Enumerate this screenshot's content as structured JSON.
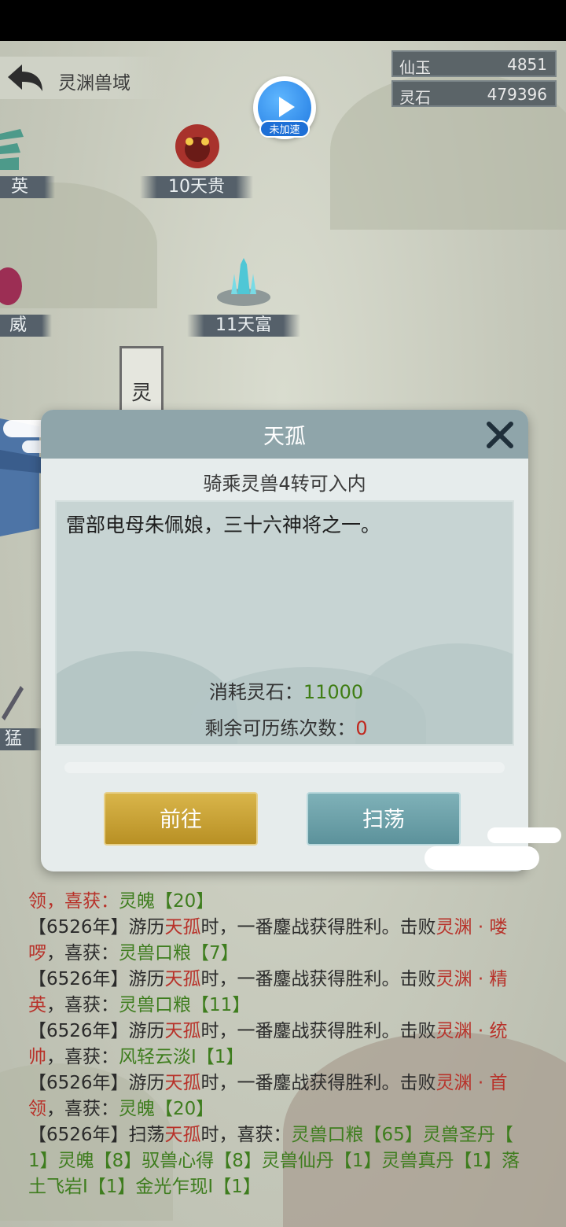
{
  "header": {
    "area_title": "灵渊兽域"
  },
  "resources": [
    {
      "label": "仙玉",
      "value": "4851"
    },
    {
      "label": "灵石",
      "value": "479396"
    }
  ],
  "speed": {
    "label": "未加速"
  },
  "map_nodes": {
    "n1": "英",
    "n2": "10天贵",
    "n3": "威",
    "n4": "11天富",
    "n5": "猛",
    "banner": "灵"
  },
  "dialog": {
    "title": "天孤",
    "requirement": "骑乘灵兽4转可入内",
    "description": "雷部电母朱佩娘，三十六神将之一。",
    "cost_label": "消耗灵石：",
    "cost_value": "11000",
    "remain_label": "剩余可历练次数：",
    "remain_value": "0",
    "go_button": "前往",
    "sweep_button": "扫荡"
  },
  "log": {
    "l1a": "领，喜获：",
    "l1b": "灵魄【20】",
    "l2a": "【6526年】游历",
    "l2b": "天孤",
    "l2c": "时，一番鏖战获得胜利。击败",
    "l2d": "灵渊 · 喽",
    "l3a": "啰",
    "l3b": "，喜获：",
    "l3c": "灵兽口粮【7】",
    "l4a": "【6526年】游历",
    "l4b": "天孤",
    "l4c": "时，一番鏖战获得胜利。击败",
    "l4d": "灵渊 · 精",
    "l5a": "英",
    "l5b": "，喜获：",
    "l5c": "灵兽口粮【11】",
    "l6a": "【6526年】游历",
    "l6b": "天孤",
    "l6c": "时，一番鏖战获得胜利。击败",
    "l6d": "灵渊 · 统",
    "l7a": "帅",
    "l7b": "，喜获：",
    "l7c": "风轻云淡I【1】",
    "l8a": "【6526年】游历",
    "l8b": "天孤",
    "l8c": "时，一番鏖战获得胜利。击败",
    "l8d": "灵渊 · 首",
    "l9a": "领",
    "l9b": "，喜获：",
    "l9c": "灵魄【20】",
    "l10a": "【6526年】扫荡",
    "l10b": "天孤",
    "l10c": "时，喜获：",
    "l10d": "灵兽口粮【65】灵兽圣丹【",
    "l11a": "1】灵魄【8】驭兽心得【8】灵兽仙丹【1】灵兽真丹【1】落",
    "l12a": "土飞岩I【1】金光乍现I【1】"
  },
  "colors": {
    "accent_gold": "#c9a232",
    "accent_teal": "#6ea2aa",
    "enemy_red": "#b8322a",
    "item_green": "#3e7d1e"
  }
}
